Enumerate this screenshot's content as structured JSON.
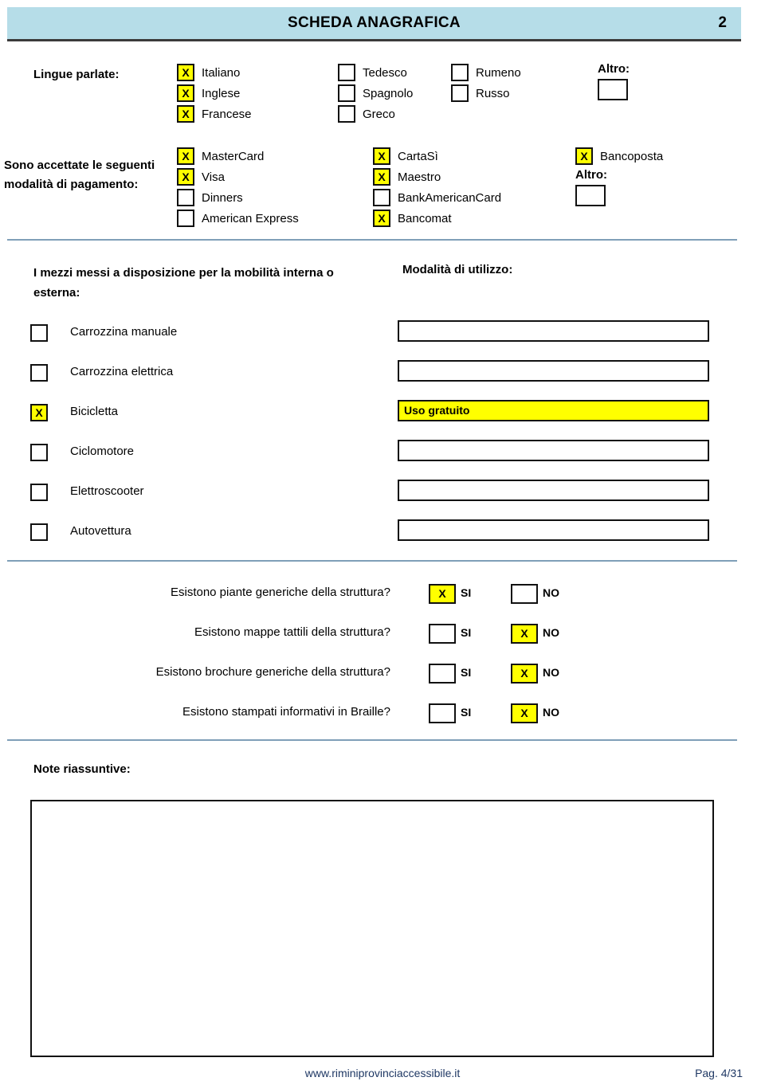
{
  "header": {
    "title": "SCHEDA ANAGRAFICA",
    "page_number": "2",
    "band_color": "#b6dde8"
  },
  "languages": {
    "label": "Lingue parlate:",
    "columns": [
      [
        {
          "label": "Italiano",
          "checked": true,
          "mark": "X"
        },
        {
          "label": "Inglese",
          "checked": true,
          "mark": "X"
        },
        {
          "label": "Francese",
          "checked": true,
          "mark": "X"
        }
      ],
      [
        {
          "label": "Tedesco",
          "checked": false,
          "mark": ""
        },
        {
          "label": "Spagnolo",
          "checked": false,
          "mark": ""
        },
        {
          "label": "Greco",
          "checked": false,
          "mark": ""
        }
      ],
      [
        {
          "label": "Rumeno",
          "checked": false,
          "mark": ""
        },
        {
          "label": "Russo",
          "checked": false,
          "mark": ""
        }
      ]
    ],
    "altro": {
      "label": "Altro:",
      "value": "",
      "checked": false
    }
  },
  "payments": {
    "label": "Sono accettate le seguenti modalità di pagamento:",
    "columns": [
      [
        {
          "label": "MasterCard",
          "checked": true,
          "mark": "X"
        },
        {
          "label": "Visa",
          "checked": true,
          "mark": "X"
        },
        {
          "label": "Dinners",
          "checked": false,
          "mark": ""
        },
        {
          "label": "American Express",
          "checked": false,
          "mark": ""
        }
      ],
      [
        {
          "label": "CartaSì",
          "checked": true,
          "mark": "X"
        },
        {
          "label": "Maestro",
          "checked": true,
          "mark": "X"
        },
        {
          "label": "BankAmericanCard",
          "checked": false,
          "mark": ""
        },
        {
          "label": "Bancomat",
          "checked": true,
          "mark": "X"
        }
      ],
      [
        {
          "label": "Bancoposta",
          "checked": true,
          "mark": "X"
        }
      ]
    ],
    "altro": {
      "label": "Altro:",
      "value": "",
      "checked": false
    }
  },
  "mobility": {
    "heading": "I mezzi messi a disposizione per la mobilità interna o esterna:",
    "usage_heading": "Modalità di utilizzo:",
    "rows": [
      {
        "label": "Carrozzina manuale",
        "checked": false,
        "mark": "",
        "usage": ""
      },
      {
        "label": "Carrozzina elettrica",
        "checked": false,
        "mark": "",
        "usage": ""
      },
      {
        "label": "Bicicletta",
        "checked": true,
        "mark": "X",
        "usage": "Uso gratuito"
      },
      {
        "label": "Ciclomotore",
        "checked": false,
        "mark": "",
        "usage": ""
      },
      {
        "label": "Elettroscooter",
        "checked": false,
        "mark": "",
        "usage": ""
      },
      {
        "label": "Autovettura",
        "checked": false,
        "mark": "",
        "usage": ""
      }
    ]
  },
  "questions": {
    "yes_label": "SI",
    "no_label": "NO",
    "rows": [
      {
        "text": "Esistono piante generiche della struttura?",
        "yes": true,
        "no": false,
        "yes_mark": "X",
        "no_mark": ""
      },
      {
        "text": "Esistono mappe tattili della struttura?",
        "yes": false,
        "no": true,
        "yes_mark": "",
        "no_mark": "X"
      },
      {
        "text": "Esistono brochure generiche  della struttura?",
        "yes": false,
        "no": true,
        "yes_mark": "",
        "no_mark": "X"
      },
      {
        "text": "Esistono stampati informativi in Braille?",
        "yes": false,
        "no": true,
        "yes_mark": "",
        "no_mark": "X"
      }
    ]
  },
  "notes": {
    "label": "Note riassuntive:",
    "value": ""
  },
  "footer": {
    "url": "www.riminiprovinciaccessibile.it",
    "page": "Pag. 4/31"
  }
}
